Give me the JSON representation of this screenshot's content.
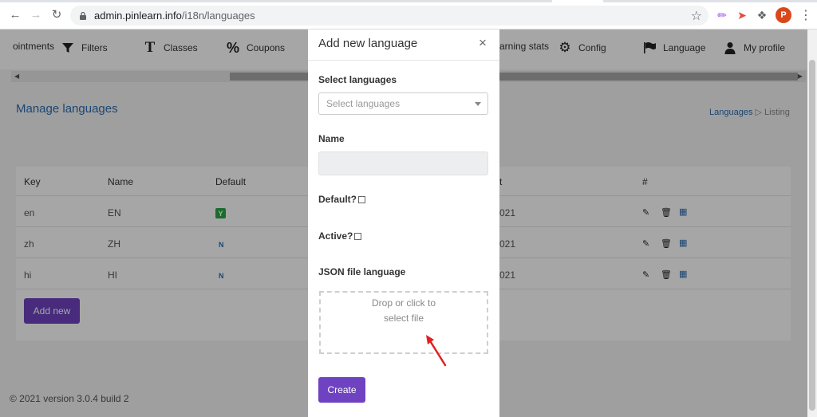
{
  "browser": {
    "url_host": "admin.pinlearn.info",
    "url_path": "/i18n/languages",
    "profile_initial": "P"
  },
  "nav": {
    "items": [
      {
        "label": "ointments",
        "icon": "calendar-icon"
      },
      {
        "label": "Filters",
        "icon": "filter-icon"
      },
      {
        "label": "Classes",
        "icon": "text-icon"
      },
      {
        "label": "Coupons",
        "icon": "percent-icon"
      },
      {
        "label": "arning stats",
        "icon": "chart-icon"
      },
      {
        "label": "Config",
        "icon": "gears-icon"
      },
      {
        "label": "Language",
        "icon": "flag-icon"
      },
      {
        "label": "My profile",
        "icon": "user-icon"
      }
    ]
  },
  "page": {
    "title": "Manage languages",
    "breadcrumb": {
      "link": "Languages",
      "current": "Listing"
    },
    "table": {
      "headers": [
        "Key",
        "Name",
        "Default",
        "t",
        "#"
      ],
      "rows": [
        {
          "key": "en",
          "name": "EN",
          "default": "Y",
          "date": "021"
        },
        {
          "key": "zh",
          "name": "ZH",
          "default": "N",
          "date": "021"
        },
        {
          "key": "hi",
          "name": "HI",
          "default": "N",
          "date": "021"
        }
      ]
    },
    "add_button": "Add new",
    "footer": "© 2021 version 3.0.4 build 2"
  },
  "modal": {
    "title": "Add new language",
    "close_glyph": "×",
    "select_label": "Select languages",
    "select_placeholder": "Select languages",
    "name_label": "Name",
    "name_value": "",
    "default_label": "Default?",
    "active_label": "Active?",
    "json_label": "JSON file language",
    "dropzone_line1": "Drop or click to",
    "dropzone_line2": "select file",
    "create_button": "Create"
  },
  "colors": {
    "primary": "#6f42c1",
    "link": "#2b6cb0",
    "success": "#28a745",
    "annotation_arrow": "#e02020"
  }
}
